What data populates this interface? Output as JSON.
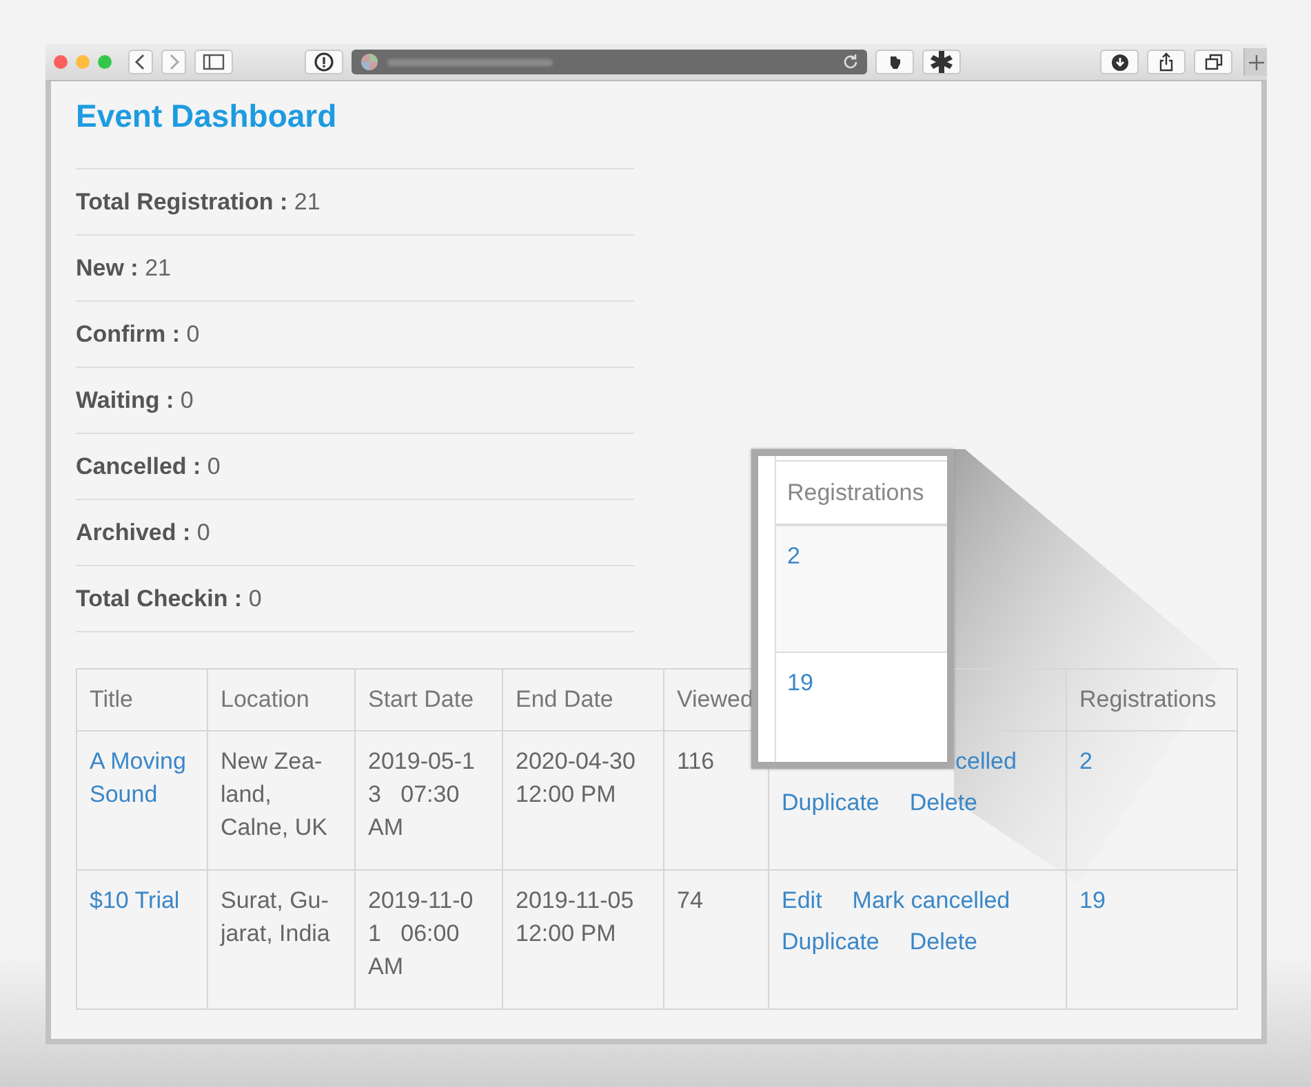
{
  "page": {
    "title": "Event Dashboard"
  },
  "stats": [
    {
      "label": "Total Registration :",
      "value": "21"
    },
    {
      "label": "New :",
      "value": "21"
    },
    {
      "label": "Confirm :",
      "value": "0"
    },
    {
      "label": "Waiting :",
      "value": "0"
    },
    {
      "label": "Cancelled :",
      "value": "0"
    },
    {
      "label": "Archived :",
      "value": "0"
    },
    {
      "label": "Total Checkin :",
      "value": "0"
    }
  ],
  "table": {
    "columns": [
      "Title",
      "Location",
      "Start Date",
      "End Date",
      "Viewed",
      "",
      "Registrations"
    ],
    "rows": [
      {
        "title": "A Moving Sound",
        "location": "New Zea-land, Calne, UK",
        "start": "2019-05-1 3   07:30 AM",
        "end": "2020-04-30 12:00 PM",
        "viewed": "116",
        "actions": [
          {
            "kind": "cut",
            "links": [
              "celled"
            ]
          },
          {
            "kind": "full",
            "links": [
              "Duplicate",
              "Delete"
            ]
          }
        ],
        "registrations": "2"
      },
      {
        "title": "$10 Trial",
        "location": "Surat, Gu-jarat, India",
        "start": "2019-11-0 1   06:00 AM",
        "end": "2019-11-05 12:00 PM",
        "viewed": "74",
        "actions": [
          {
            "kind": "full",
            "links": [
              "Edit",
              "Mark cancelled"
            ]
          },
          {
            "kind": "full",
            "links": [
              "Duplicate",
              "Delete"
            ]
          }
        ],
        "registrations": "19"
      }
    ]
  },
  "magnifier": {
    "header": "Registrations",
    "cells": [
      "2",
      "19"
    ]
  }
}
